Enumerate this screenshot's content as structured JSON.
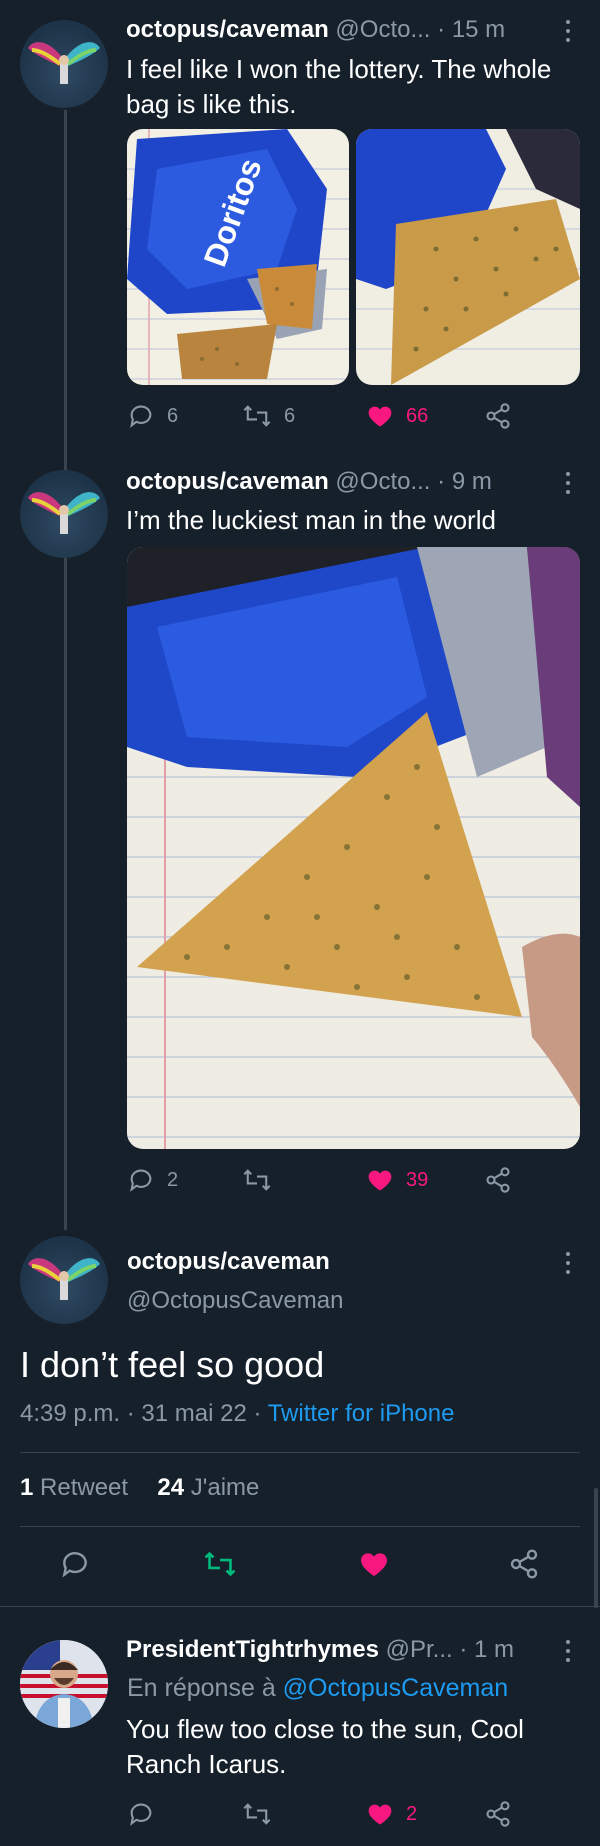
{
  "colors": {
    "background": "#15202b",
    "accent": "#1d9bf0",
    "like": "#f91880",
    "retweet_active": "#00ba7c",
    "muted": "#8b98a5"
  },
  "tweet1": {
    "name": "octopus/caveman",
    "handle": "@Octo...",
    "time": "15 m",
    "text": "I feel like I won the lottery. The whole bag is like this.",
    "replies": "6",
    "retweets": "6",
    "likes": "66"
  },
  "tweet2": {
    "name": "octopus/caveman",
    "handle": "@Octo...",
    "time": "9 m",
    "text": "I’m the luckiest man in the world",
    "replies": "2",
    "retweets": "",
    "likes": "39"
  },
  "main": {
    "name": "octopus/caveman",
    "handle": "@OctopusCaveman",
    "text": "I don’t feel so good",
    "time": "4:39 p.m.",
    "date": "31 mai 22",
    "source": "Twitter for iPhone",
    "retweets_count": "1",
    "retweets_label": "Retweet",
    "likes_count": "24",
    "likes_label": "J'aime"
  },
  "reply": {
    "name": "PresidentTightrhymes",
    "handle": "@Pr...",
    "time": "1 m",
    "reply_prefix": "En réponse à",
    "reply_to": "@OctopusCaveman",
    "text": "You flew too close to the sun, Cool Ranch Icarus.",
    "replies": "",
    "retweets": "",
    "likes": "2"
  },
  "icons": [
    "reply-icon",
    "retweet-icon",
    "heart-icon",
    "share-icon",
    "more-icon"
  ]
}
